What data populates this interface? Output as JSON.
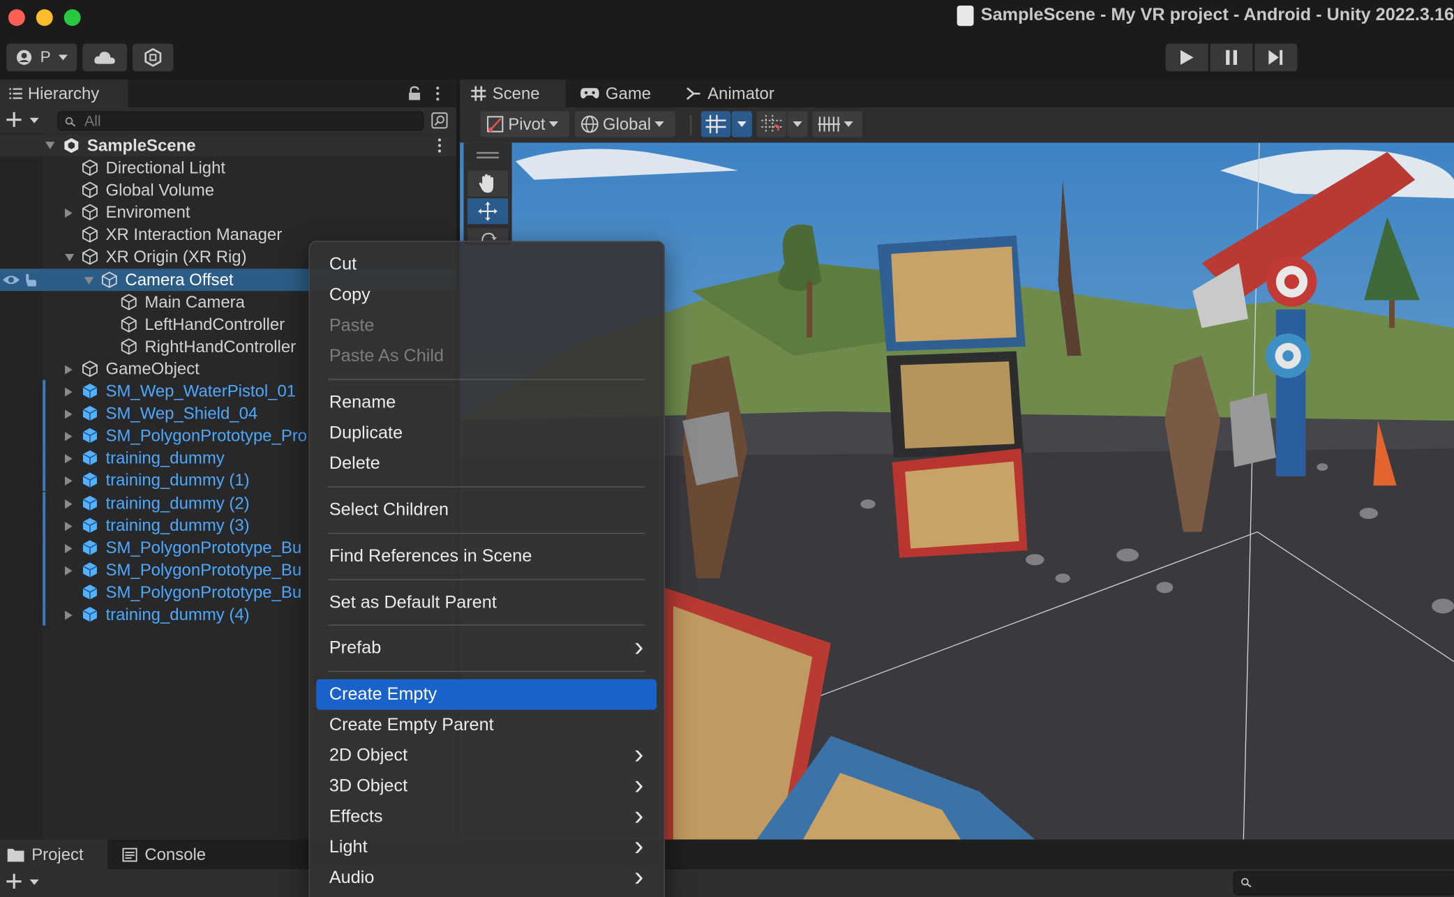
{
  "window": {
    "title": "SampleScene - My VR project - Android - Unity 2022.3.16",
    "traffic_colors": [
      "#ff5f57",
      "#febc2e",
      "#28c840"
    ]
  },
  "toolbar": {
    "account_label": "P",
    "play_icon": "play-icon",
    "pause_icon": "pause-icon",
    "step_icon": "step-icon"
  },
  "hierarchy": {
    "tab_label": "Hierarchy",
    "search_placeholder": "All",
    "scene_name": "SampleScene",
    "items": [
      {
        "label": "Directional Light"
      },
      {
        "label": "Global Volume"
      },
      {
        "label": "Enviroment"
      },
      {
        "label": "XR Interaction Manager"
      },
      {
        "label": "XR Origin (XR Rig)"
      },
      {
        "label": "Camera Offset"
      },
      {
        "label": "Main Camera"
      },
      {
        "label": "LeftHandController"
      },
      {
        "label": "RightHandController"
      },
      {
        "label": "GameObject"
      },
      {
        "label": "SM_Wep_WaterPistol_01"
      },
      {
        "label": "SM_Wep_Shield_04"
      },
      {
        "label": "SM_PolygonPrototype_Pro"
      },
      {
        "label": "training_dummy"
      },
      {
        "label": "training_dummy (1)"
      },
      {
        "label": "training_dummy (2)"
      },
      {
        "label": "training_dummy (3)"
      },
      {
        "label": "SM_PolygonPrototype_Bu"
      },
      {
        "label": "SM_PolygonPrototype_Bu"
      },
      {
        "label": "SM_PolygonPrototype_Bu"
      },
      {
        "label": "training_dummy (4)"
      }
    ],
    "selected_color": "#2c5d87",
    "prefab_color": "#4fa8ff"
  },
  "scene": {
    "tabs": [
      {
        "label": "Scene",
        "icon": "grid-icon"
      },
      {
        "label": "Game",
        "icon": "gamepad-icon"
      },
      {
        "label": "Animator",
        "icon": "animator-icon"
      }
    ],
    "pivot_label": "Pivot",
    "global_label": "Global"
  },
  "bottom": {
    "tabs": [
      {
        "label": "Project",
        "icon": "folder-icon"
      },
      {
        "label": "Console",
        "icon": "console-icon"
      }
    ]
  },
  "context_menu": {
    "items": [
      {
        "label": "Cut"
      },
      {
        "label": "Copy"
      },
      {
        "label": "Paste"
      },
      {
        "label": "Paste As Child"
      },
      {
        "label": "Rename"
      },
      {
        "label": "Duplicate"
      },
      {
        "label": "Delete"
      },
      {
        "label": "Select Children"
      },
      {
        "label": "Find References in Scene"
      },
      {
        "label": "Set as Default Parent"
      },
      {
        "label": "Prefab"
      },
      {
        "label": "Create Empty"
      },
      {
        "label": "Create Empty Parent"
      },
      {
        "label": "2D Object"
      },
      {
        "label": "3D Object"
      },
      {
        "label": "Effects"
      },
      {
        "label": "Light"
      },
      {
        "label": "Audio"
      }
    ],
    "active_color": "#1862c9"
  }
}
